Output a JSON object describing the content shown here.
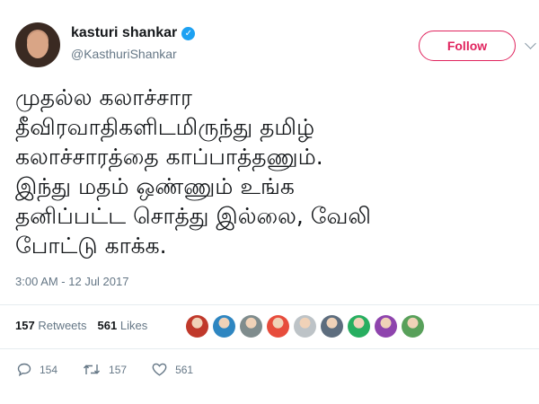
{
  "user": {
    "display_name": "kasturi shankar",
    "verified_icon": "verified-badge-icon",
    "handle": "@KasthuriShankar"
  },
  "follow_label": "Follow",
  "tweet": {
    "text": "முதல்ல கலாச்சார\nதீவிரவாதிகளிடமிருந்து தமிழ்\nகலாச்சாரத்தை காப்பாத்தணும்.\nஇந்து மதம் ஒண்ணும் உங்க\nதனிப்பட்ட சொத்து இல்லை, வேலி\nபோட்டு காக்க."
  },
  "timestamp": "3:00 AM - 12 Jul 2017",
  "stats": {
    "retweets_count": "157",
    "retweets_label": "Retweets",
    "likes_count": "561",
    "likes_label": "Likes"
  },
  "likers": [
    {
      "color": "#c0392b"
    },
    {
      "color": "#2e86c1"
    },
    {
      "color": "#7f8c8d"
    },
    {
      "color": "#e74c3c"
    },
    {
      "color": "#bdc3c7"
    },
    {
      "color": "#5d6d7e"
    },
    {
      "color": "#27ae60"
    },
    {
      "color": "#8e44ad"
    },
    {
      "color": "#58a05a"
    }
  ],
  "actions": {
    "reply_count": "154",
    "retweet_count": "157",
    "like_count": "561"
  },
  "colors": {
    "accent": "#e0245e",
    "verified": "#1da1f2",
    "muted": "#657786"
  }
}
